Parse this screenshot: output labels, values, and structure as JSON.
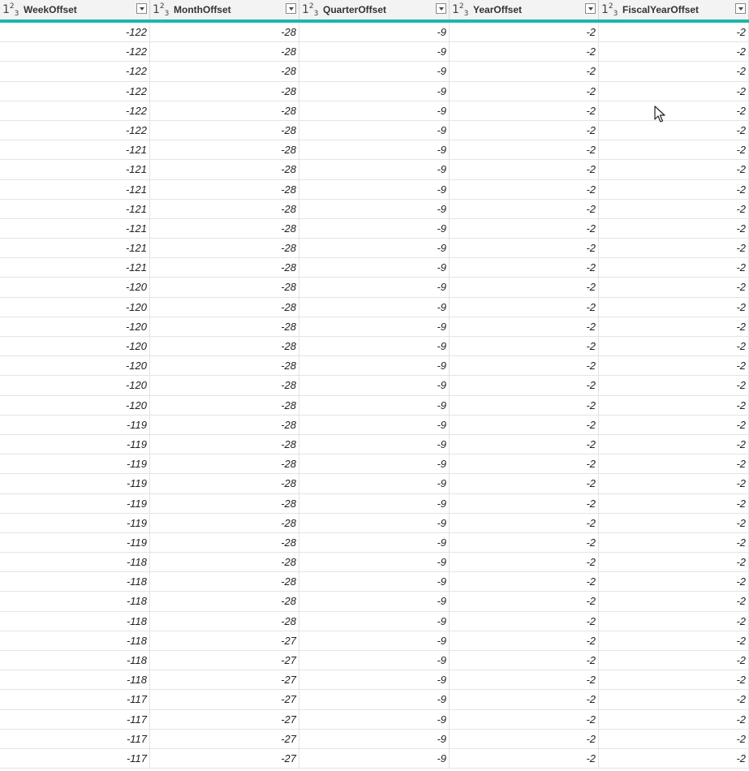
{
  "columns": [
    {
      "name": "WeekOffset",
      "type_icon": "number-type-icon"
    },
    {
      "name": "MonthOffset",
      "type_icon": "number-type-icon"
    },
    {
      "name": "QuarterOffset",
      "type_icon": "number-type-icon"
    },
    {
      "name": "YearOffset",
      "type_icon": "number-type-icon"
    },
    {
      "name": "FiscalYearOffset",
      "type_icon": "number-type-icon"
    }
  ],
  "type_glyph": {
    "base": "1",
    "sup": "2",
    "sub": "3"
  },
  "rows": [
    [
      "-122",
      "-28",
      "-9",
      "-2",
      "-2"
    ],
    [
      "-122",
      "-28",
      "-9",
      "-2",
      "-2"
    ],
    [
      "-122",
      "-28",
      "-9",
      "-2",
      "-2"
    ],
    [
      "-122",
      "-28",
      "-9",
      "-2",
      "-2"
    ],
    [
      "-122",
      "-28",
      "-9",
      "-2",
      "-2"
    ],
    [
      "-122",
      "-28",
      "-9",
      "-2",
      "-2"
    ],
    [
      "-121",
      "-28",
      "-9",
      "-2",
      "-2"
    ],
    [
      "-121",
      "-28",
      "-9",
      "-2",
      "-2"
    ],
    [
      "-121",
      "-28",
      "-9",
      "-2",
      "-2"
    ],
    [
      "-121",
      "-28",
      "-9",
      "-2",
      "-2"
    ],
    [
      "-121",
      "-28",
      "-9",
      "-2",
      "-2"
    ],
    [
      "-121",
      "-28",
      "-9",
      "-2",
      "-2"
    ],
    [
      "-121",
      "-28",
      "-9",
      "-2",
      "-2"
    ],
    [
      "-120",
      "-28",
      "-9",
      "-2",
      "-2"
    ],
    [
      "-120",
      "-28",
      "-9",
      "-2",
      "-2"
    ],
    [
      "-120",
      "-28",
      "-9",
      "-2",
      "-2"
    ],
    [
      "-120",
      "-28",
      "-9",
      "-2",
      "-2"
    ],
    [
      "-120",
      "-28",
      "-9",
      "-2",
      "-2"
    ],
    [
      "-120",
      "-28",
      "-9",
      "-2",
      "-2"
    ],
    [
      "-120",
      "-28",
      "-9",
      "-2",
      "-2"
    ],
    [
      "-119",
      "-28",
      "-9",
      "-2",
      "-2"
    ],
    [
      "-119",
      "-28",
      "-9",
      "-2",
      "-2"
    ],
    [
      "-119",
      "-28",
      "-9",
      "-2",
      "-2"
    ],
    [
      "-119",
      "-28",
      "-9",
      "-2",
      "-2"
    ],
    [
      "-119",
      "-28",
      "-9",
      "-2",
      "-2"
    ],
    [
      "-119",
      "-28",
      "-9",
      "-2",
      "-2"
    ],
    [
      "-119",
      "-28",
      "-9",
      "-2",
      "-2"
    ],
    [
      "-118",
      "-28",
      "-9",
      "-2",
      "-2"
    ],
    [
      "-118",
      "-28",
      "-9",
      "-2",
      "-2"
    ],
    [
      "-118",
      "-28",
      "-9",
      "-2",
      "-2"
    ],
    [
      "-118",
      "-28",
      "-9",
      "-2",
      "-2"
    ],
    [
      "-118",
      "-27",
      "-9",
      "-2",
      "-2"
    ],
    [
      "-118",
      "-27",
      "-9",
      "-2",
      "-2"
    ],
    [
      "-118",
      "-27",
      "-9",
      "-2",
      "-2"
    ],
    [
      "-117",
      "-27",
      "-9",
      "-2",
      "-2"
    ],
    [
      "-117",
      "-27",
      "-9",
      "-2",
      "-2"
    ],
    [
      "-117",
      "-27",
      "-9",
      "-2",
      "-2"
    ],
    [
      "-117",
      "-27",
      "-9",
      "-2",
      "-2"
    ]
  ],
  "colors": {
    "header_accent": "#1fb5ac",
    "header_bg": "#f3f3f3",
    "grid_line": "#e4e4e4"
  }
}
